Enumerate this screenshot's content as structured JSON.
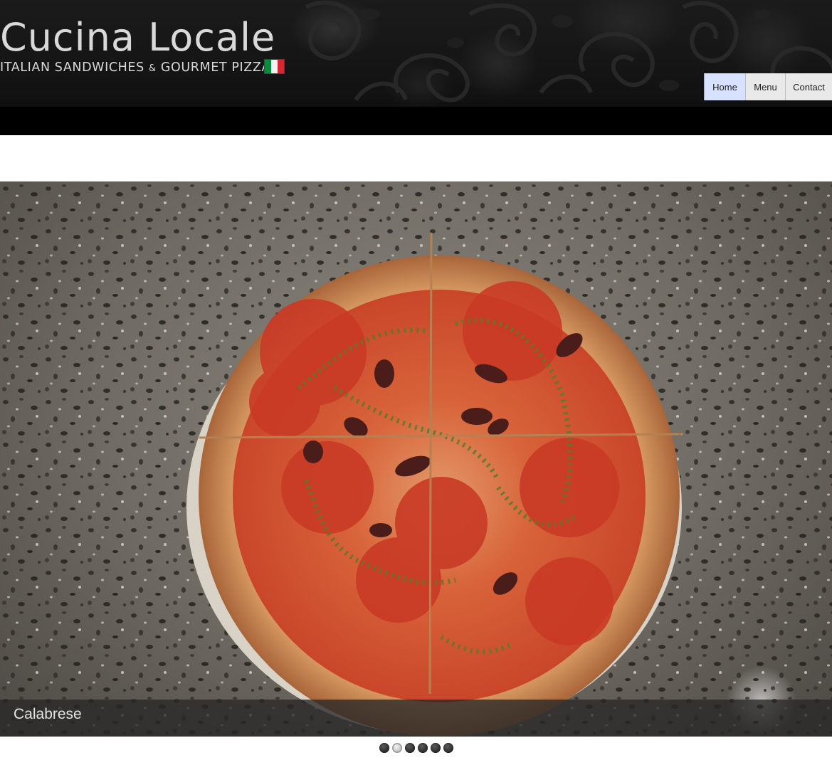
{
  "header": {
    "title": "Cucina Locale",
    "tagline_part1": "ITALIAN SANDWICHES ",
    "tagline_amp": "&",
    "tagline_part2": " GOURMET PIZZAS",
    "flag_colors": [
      "#0b8a3e",
      "#f4f4f4",
      "#d7262f"
    ]
  },
  "nav": {
    "items": [
      {
        "label": "Home",
        "active": true
      },
      {
        "label": "Menu",
        "active": false
      },
      {
        "label": "Contact",
        "active": false
      }
    ]
  },
  "slider": {
    "caption": "Calabrese",
    "slide_count": 6,
    "active_index": 1
  },
  "colors": {
    "header_bg": "#000000",
    "nav_active": "#d6e2ff",
    "nav_bg": "#e9e9e9",
    "caption_bg": "#282828"
  }
}
